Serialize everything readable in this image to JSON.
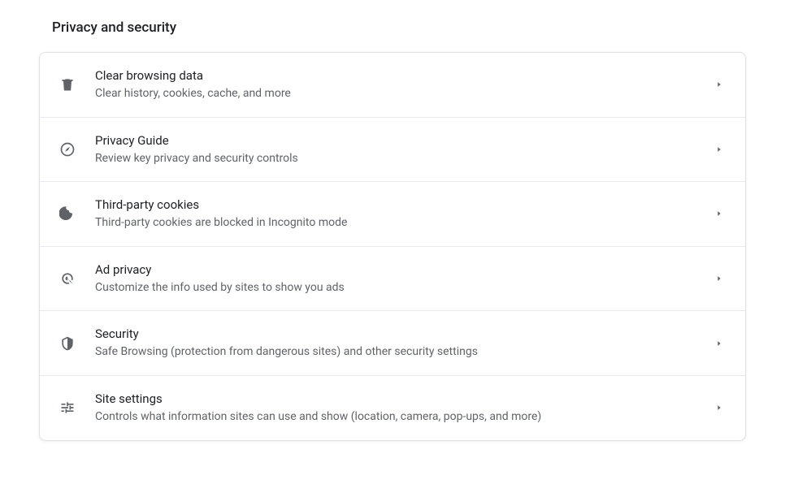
{
  "section": {
    "title": "Privacy and security"
  },
  "items": [
    {
      "title": "Clear browsing data",
      "sub": "Clear history, cookies, cache, and more"
    },
    {
      "title": "Privacy Guide",
      "sub": "Review key privacy and security controls"
    },
    {
      "title": "Third-party cookies",
      "sub": "Third-party cookies are blocked in Incognito mode"
    },
    {
      "title": "Ad privacy",
      "sub": "Customize the info used by sites to show you ads"
    },
    {
      "title": "Security",
      "sub": "Safe Browsing (protection from dangerous sites) and other security settings"
    },
    {
      "title": "Site settings",
      "sub": "Controls what information sites can use and show (location, camera, pop-ups, and more)"
    }
  ]
}
